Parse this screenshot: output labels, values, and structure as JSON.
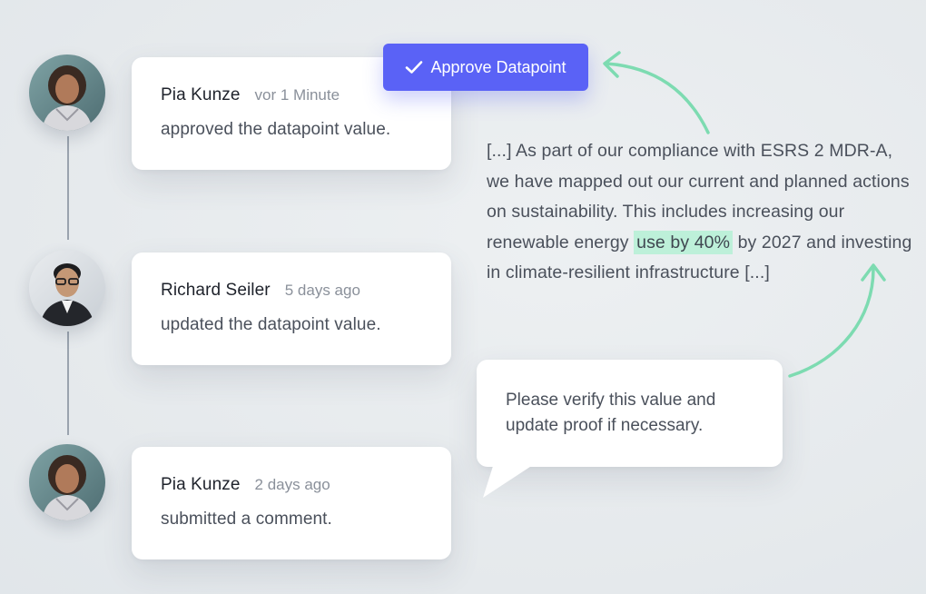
{
  "timeline": {
    "entries": [
      {
        "name": "Pia Kunze",
        "time": "vor 1 Minute",
        "action": "approved the datapoint value."
      },
      {
        "name": "Richard Seiler",
        "time": "5 days ago",
        "action": "updated the datapoint value."
      },
      {
        "name": "Pia Kunze",
        "time": "2 days ago",
        "action": "submitted a comment."
      }
    ]
  },
  "approve_button": {
    "label": "Approve Datapoint",
    "icon": "check-icon"
  },
  "excerpt": {
    "before": "[...] As part of our compliance with ESRS 2 MDR-A, we have mapped out our current and planned actions on sustainability. This includes increasing our renewable energy ",
    "highlight": "use by 40%",
    "after": " by 2027 and investing in climate-resilient infrastructure [...]"
  },
  "comment": {
    "text": "Please verify this value and update proof if necessary."
  },
  "colors": {
    "accent": "#5a62f6",
    "highlight": "#bdf0d9",
    "arrow": "#7ddbb1",
    "timeline_line": "#9aa3ae"
  }
}
